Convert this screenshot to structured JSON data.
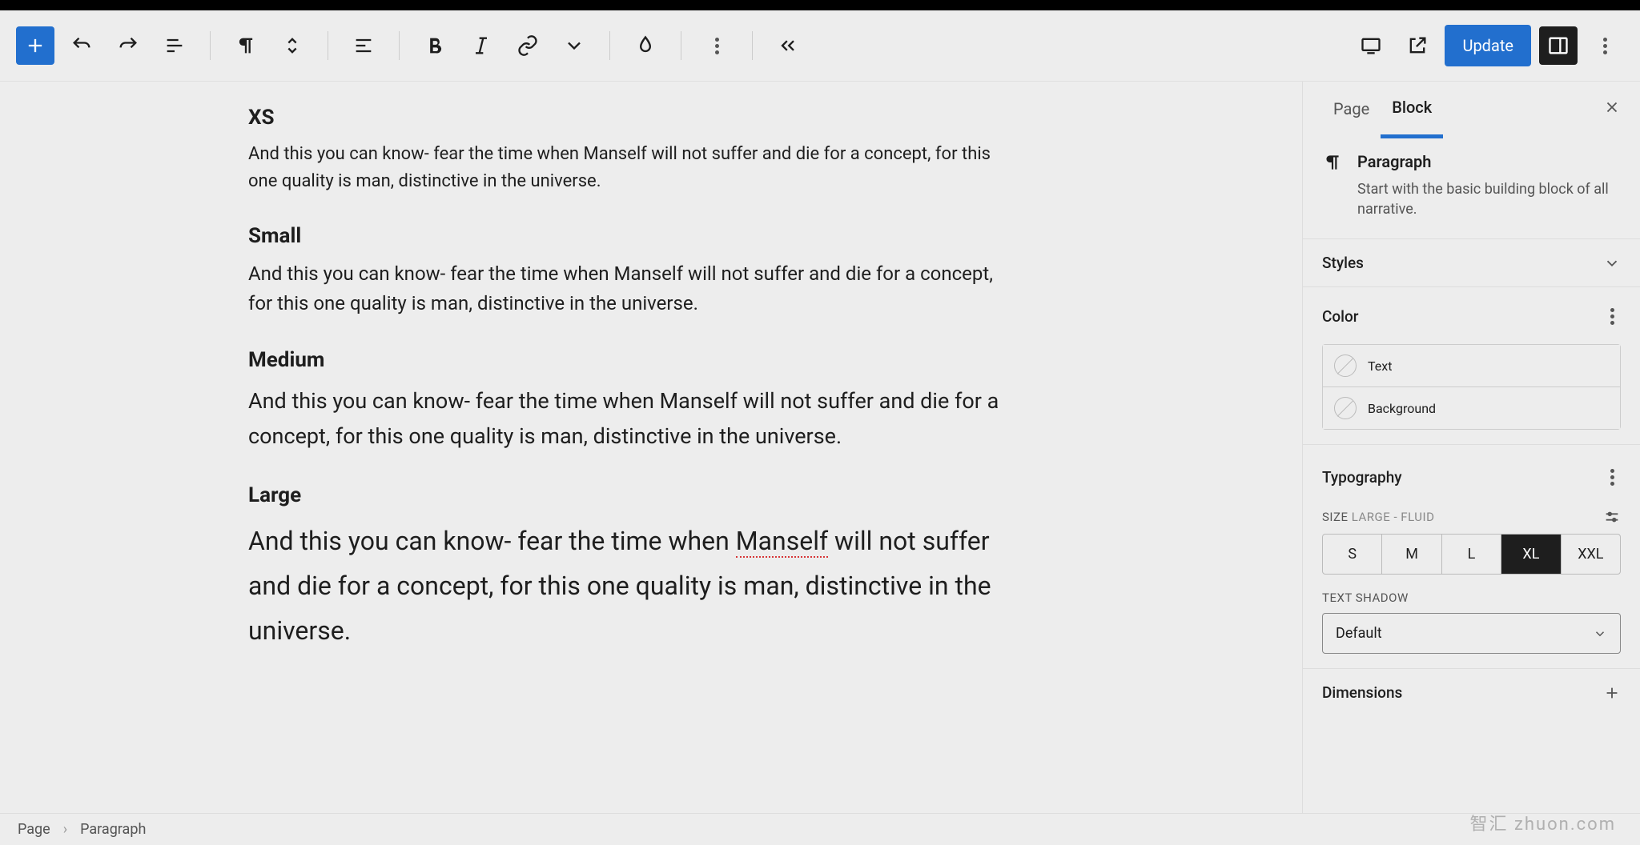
{
  "toolbar": {
    "update_label": "Update"
  },
  "content": {
    "sample_text": "And this you can know- fear the time when Manself will not suffer and die for a concept, for this one quality is man, distinctive in the universe.",
    "headings": {
      "xs": "XS",
      "small": "Small",
      "medium": "Medium",
      "large": "Large"
    }
  },
  "sidebar": {
    "tabs": {
      "page": "Page",
      "block": "Block"
    },
    "block": {
      "title": "Paragraph",
      "desc": "Start with the basic building block of all narrative."
    },
    "styles_label": "Styles",
    "color": {
      "label": "Color",
      "text": "Text",
      "background": "Background"
    },
    "typography": {
      "label": "Typography",
      "size_label": "SIZE",
      "size_value": "LARGE - FLUID",
      "sizes": [
        "S",
        "M",
        "L",
        "XL",
        "XXL"
      ],
      "selected_size": "XL",
      "text_shadow_label": "TEXT SHADOW",
      "text_shadow_value": "Default"
    },
    "dimensions_label": "Dimensions"
  },
  "breadcrumb": {
    "root": "Page",
    "current": "Paragraph"
  },
  "watermark": "智汇 zhuon.com"
}
